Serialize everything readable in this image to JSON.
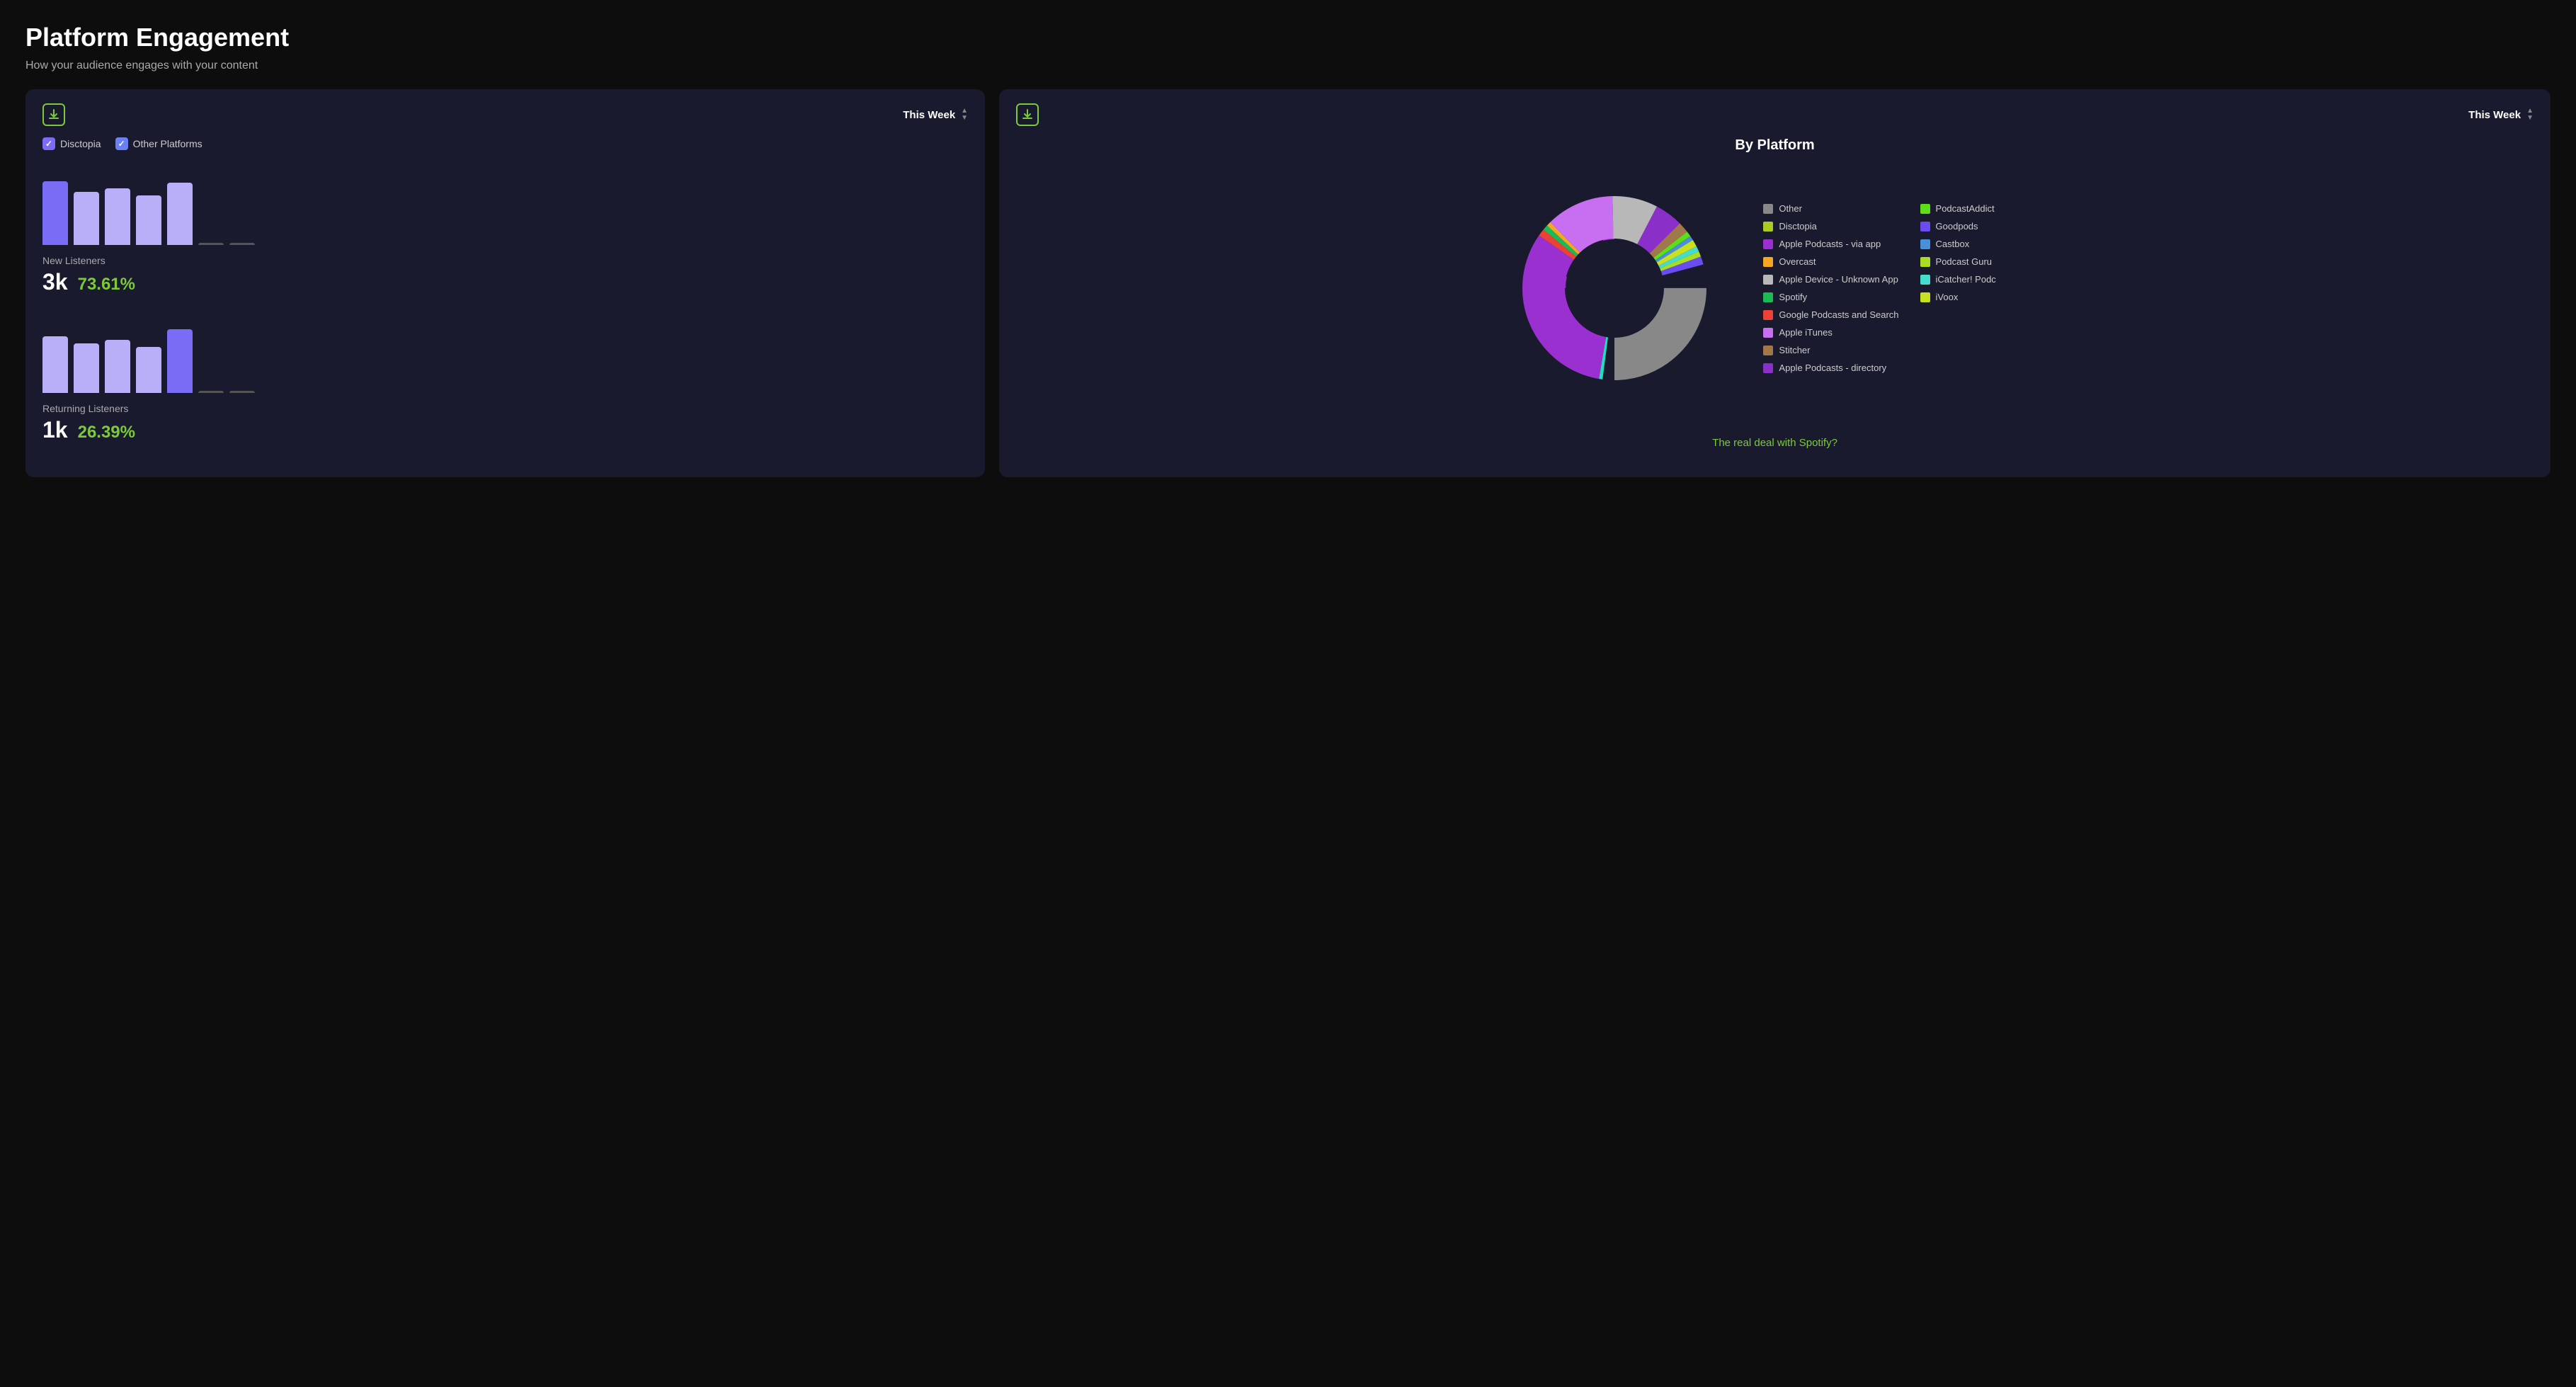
{
  "page": {
    "title": "Platform Engagement",
    "subtitle": "How your audience engages with your content"
  },
  "left_card": {
    "download_icon": "↓",
    "week_label": "This Week",
    "legend": [
      {
        "label": "Disctopia",
        "color": "purple"
      },
      {
        "label": "Other Platforms",
        "color": "blue"
      }
    ],
    "new_listeners": {
      "label": "New Listeners",
      "count": "3k",
      "percent": "73.61%"
    },
    "returning_listeners": {
      "label": "Returning Listeners",
      "count": "1k",
      "percent": "26.39%"
    }
  },
  "right_card": {
    "download_icon": "↓",
    "week_label": "This Week",
    "chart_title": "By Platform",
    "bottom_note": "The real deal with Spotify?",
    "legend_items": [
      {
        "label": "Other",
        "color": "#888888"
      },
      {
        "label": "Disctopia",
        "color": "#9ec e22"
      },
      {
        "label": "Apple Podcasts - via app",
        "color": "#9b30d0"
      },
      {
        "label": "Overcast",
        "color": "#f5a623"
      },
      {
        "label": "Apple Device - Unknown App",
        "color": "#b0b0b0"
      },
      {
        "label": "Spotify",
        "color": "#1db954"
      },
      {
        "label": "Google Podcasts and Search",
        "color": "#ea4335"
      },
      {
        "label": "Apple iTunes",
        "color": "#c86ef0"
      },
      {
        "label": "Stitcher",
        "color": "#a0784a"
      },
      {
        "label": "Apple Podcasts - directory",
        "color": "#8b2fc9"
      },
      {
        "label": "PodcastAddict",
        "color": "#5dde17"
      },
      {
        "label": "Goodpods",
        "color": "#6a4cf0"
      },
      {
        "label": "Castbox",
        "color": "#4a90d9"
      },
      {
        "label": "Podcast Guru",
        "color": "#aadd22"
      },
      {
        "label": "iCatcher! Podc",
        "color": "#44ddcc"
      },
      {
        "label": "iVoox",
        "color": "#c8e020"
      }
    ]
  }
}
